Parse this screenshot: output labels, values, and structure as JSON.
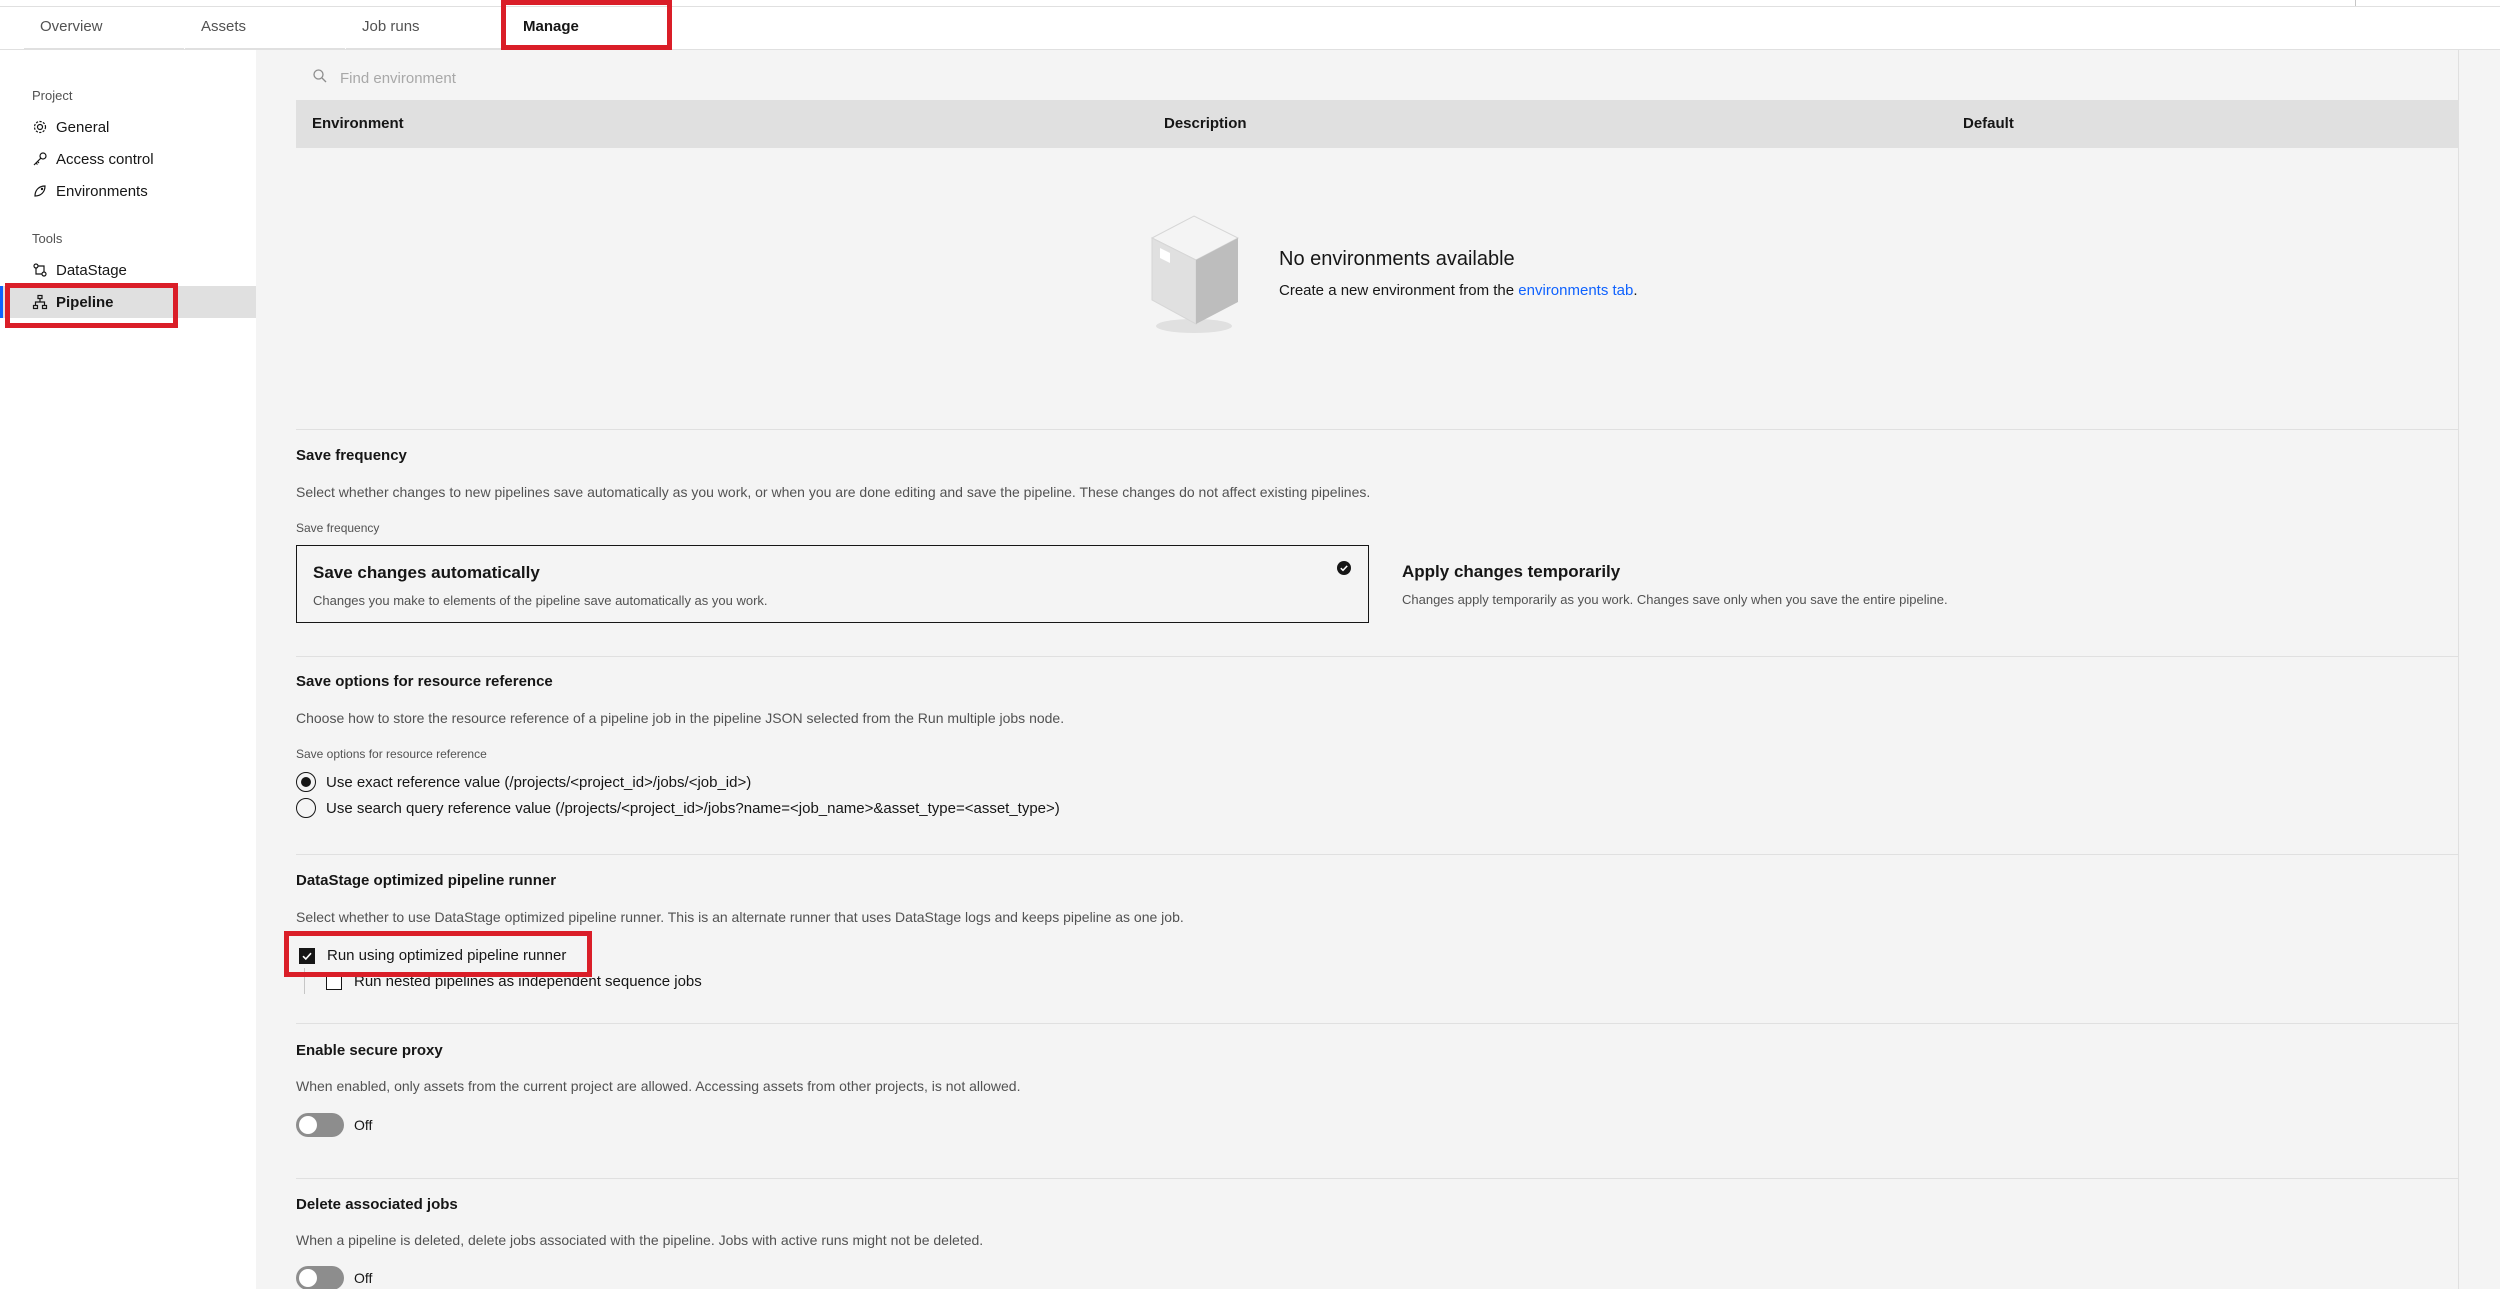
{
  "tabs": {
    "overview": "Overview",
    "assets": "Assets",
    "job_runs": "Job runs",
    "manage": "Manage"
  },
  "sidebar": {
    "project_group": "Project",
    "tools_group": "Tools",
    "items": [
      {
        "label": "General",
        "icon": "gear-icon"
      },
      {
        "label": "Access control",
        "icon": "key-icon"
      },
      {
        "label": "Environments",
        "icon": "environment-icon"
      },
      {
        "label": "DataStage",
        "icon": "datastage-icon"
      },
      {
        "label": "Pipeline",
        "icon": "pipeline-icon",
        "active": true
      }
    ]
  },
  "environments": {
    "search_placeholder": "Find environment",
    "columns": [
      "Environment",
      "Description",
      "Default"
    ],
    "empty_title": "No environments available",
    "empty_desc_prefix": "Create a new environment from the ",
    "empty_desc_link": "environments tab",
    "empty_desc_suffix": "."
  },
  "save_frequency": {
    "title": "Save frequency",
    "description": "Select whether changes to new pipelines save automatically as you work, or when you are done editing and save the pipeline. These changes do not affect existing pipelines.",
    "label": "Save frequency",
    "options": [
      {
        "title": "Save changes automatically",
        "desc": "Changes you make to elements of the pipeline save automatically as you work.",
        "selected": true
      },
      {
        "title": "Apply changes temporarily",
        "desc": "Changes apply temporarily as you work. Changes save only when you save the entire pipeline.",
        "selected": false
      }
    ]
  },
  "resource_reference": {
    "title": "Save options for resource reference",
    "description": "Choose how to store the resource reference of a pipeline job in the pipeline JSON selected from the Run multiple jobs node.",
    "label": "Save options for resource reference",
    "options": [
      {
        "label": "Use exact reference value (/projects/<project_id>/jobs/<job_id>)",
        "selected": true
      },
      {
        "label": "Use search query reference value (/projects/<project_id>/jobs?name=<job_name>&asset_type=<asset_type>)",
        "selected": false
      }
    ]
  },
  "optimized_runner": {
    "title": "DataStage optimized pipeline runner",
    "description": "Select whether to use DataStage optimized pipeline runner. This is an alternate runner that uses DataStage logs and keeps pipeline as one job.",
    "run_optimized_label": "Run using optimized pipeline runner",
    "run_optimized_checked": true,
    "nested_label": "Run nested pipelines as independent sequence jobs",
    "nested_checked": false
  },
  "secure_proxy": {
    "title": "Enable secure proxy",
    "description": "When enabled, only assets from the current project are allowed. Accessing assets from other projects, is not allowed.",
    "state_label": "Off"
  },
  "delete_jobs": {
    "title": "Delete associated jobs",
    "description": "When a pipeline is deleted, delete jobs associated with the pipeline. Jobs with active runs might not be deleted.",
    "state_label": "Off"
  },
  "colors": {
    "accent": "#0f62fe",
    "highlight": "#da1e28"
  }
}
